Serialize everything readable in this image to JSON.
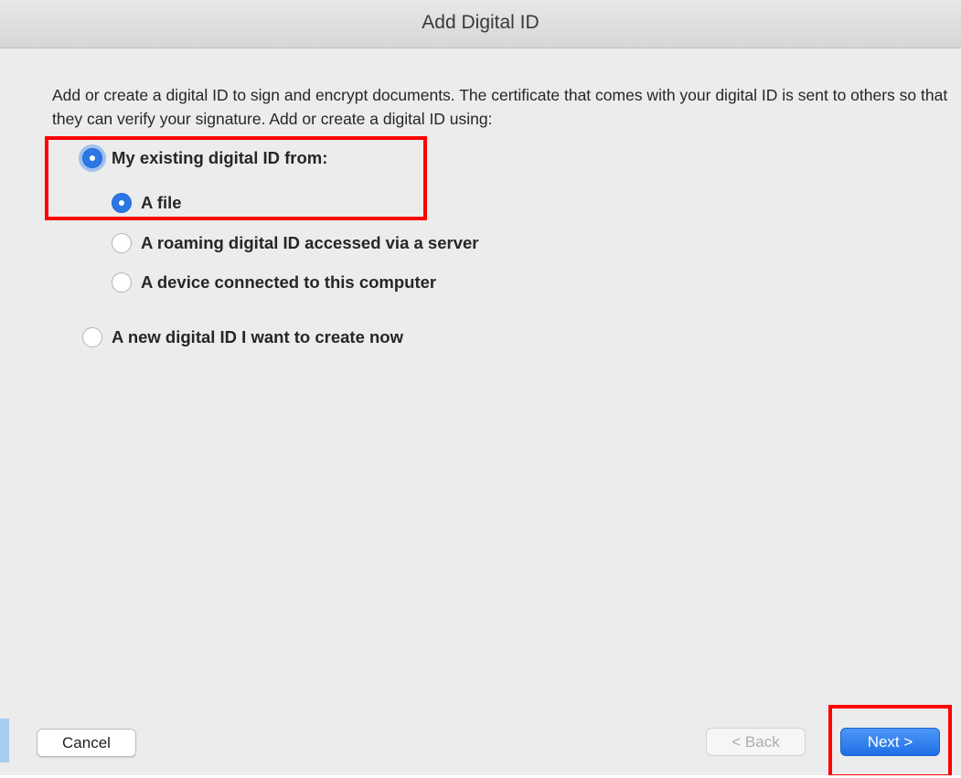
{
  "window": {
    "title": "Add Digital ID"
  },
  "description": "Add or create a digital ID to sign and encrypt documents. The certificate that comes with your digital ID is sent to others so that they can verify your signature. Add or create a digital ID using:",
  "options": {
    "existing": {
      "label": "My existing digital ID from:",
      "checked": true
    },
    "file": {
      "label": "A file",
      "checked": true
    },
    "roaming": {
      "label": "A roaming digital ID accessed via a server",
      "checked": false
    },
    "device": {
      "label": "A device connected to this computer",
      "checked": false
    },
    "new_id": {
      "label": "A new digital ID I want to create now",
      "checked": false
    }
  },
  "buttons": {
    "cancel": "Cancel",
    "back": "< Back",
    "next": "Next >"
  },
  "colors": {
    "accent": "#2c77e6",
    "highlight": "#ff0000"
  }
}
